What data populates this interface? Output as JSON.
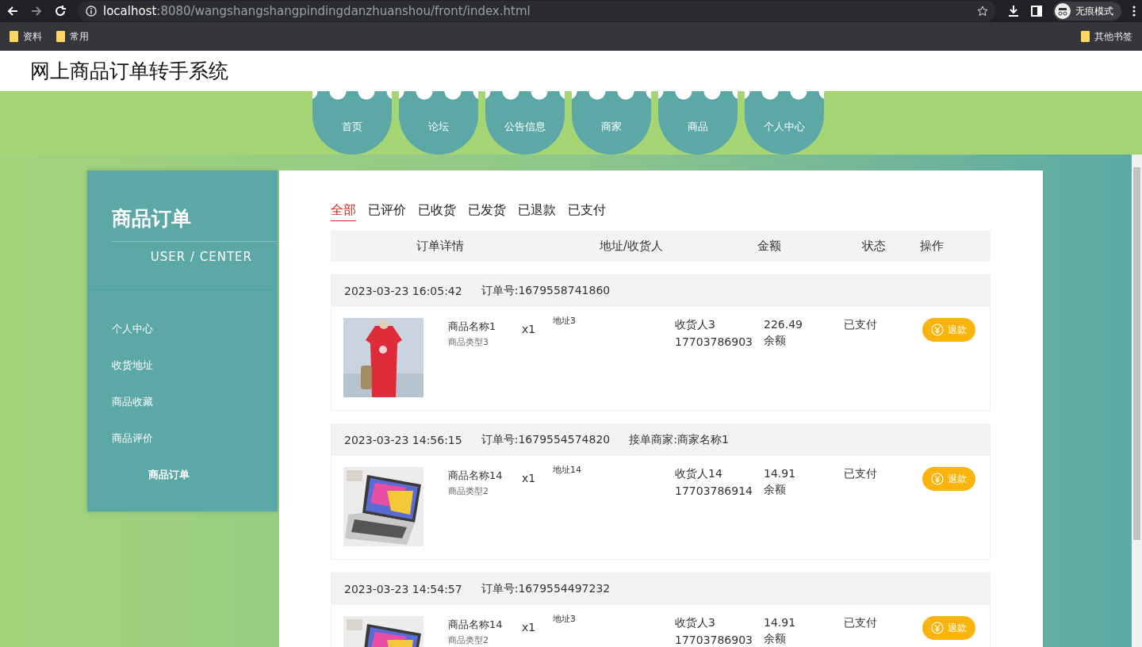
{
  "browser": {
    "url_host": "localhost",
    "url_rest": ":8080/wangshangshangpindingdanzhuanshou/front/index.html",
    "bookmarks": [
      "资料",
      "常用"
    ],
    "other_bookmarks": "其他书签",
    "profile": "无痕模式"
  },
  "site_title": "网上商品订单转手系统",
  "nav": [
    "首页",
    "论坛",
    "公告信息",
    "商家",
    "商品",
    "个人中心"
  ],
  "sidebar": {
    "title": "商品订单",
    "subtitle": "USER / CENTER",
    "items": [
      {
        "label": "个人中心",
        "selected": false
      },
      {
        "label": "收货地址",
        "selected": false
      },
      {
        "label": "商品收藏",
        "selected": false
      },
      {
        "label": "商品评价",
        "selected": false
      },
      {
        "label": "商品订单",
        "selected": true
      }
    ]
  },
  "tabs": [
    {
      "label": "全部",
      "selected": true
    },
    {
      "label": "已评价",
      "selected": false
    },
    {
      "label": "已收货",
      "selected": false
    },
    {
      "label": "已发货",
      "selected": false
    },
    {
      "label": "已退款",
      "selected": false
    },
    {
      "label": "已支付",
      "selected": false
    }
  ],
  "columns": [
    "订单详情",
    "地址/收货人",
    "金额",
    "状态",
    "操作"
  ],
  "orders": [
    {
      "time": "2023-03-23 16:05:42",
      "order_no": "订单号:1679558741860",
      "product_name": "商品名称1",
      "product_type": "商品类型3",
      "quantity": "x1",
      "address": "地址3",
      "receiver": "收货人3",
      "phone": "17703786903",
      "amount": "226.49",
      "payment": "余额",
      "status": "已支付",
      "action": "退款"
    },
    {
      "time": "2023-03-23 14:56:15",
      "order_no": "订单号:1679554574820",
      "merchant": "接单商家:商家名称1",
      "product_name": "商品名称14",
      "product_type": "商品类型2",
      "quantity": "x1",
      "address": "地址14",
      "receiver": "收货人14",
      "phone": "17703786914",
      "amount": "14.91",
      "payment": "余额",
      "status": "已支付",
      "action": "退款"
    },
    {
      "time": "2023-03-23 14:54:57",
      "order_no": "订单号:1679554497232",
      "product_name": "商品名称14",
      "product_type": "商品类型2",
      "quantity": "x1",
      "address": "地址3",
      "receiver": "收货人3",
      "phone": "17703786903",
      "amount": "14.91",
      "payment": "余额",
      "status": "已支付",
      "action": "退款"
    }
  ]
}
